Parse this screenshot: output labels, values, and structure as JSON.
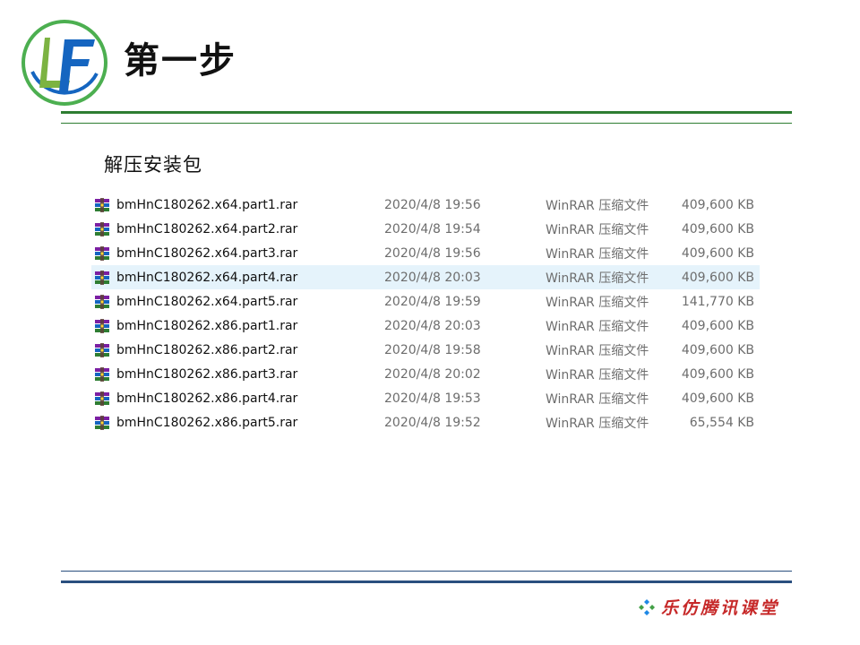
{
  "header": {
    "logo_text": "LF",
    "title": "第一步"
  },
  "section": {
    "subtitle": "解压安装包"
  },
  "files": [
    {
      "name": "bmHnC180262.x64.part1.rar",
      "date": "2020/4/8 19:56",
      "type": "WinRAR 压缩文件",
      "size": "409,600 KB",
      "icon": "winrar-archive-icon",
      "selected": false
    },
    {
      "name": "bmHnC180262.x64.part2.rar",
      "date": "2020/4/8 19:54",
      "type": "WinRAR 压缩文件",
      "size": "409,600 KB",
      "icon": "winrar-archive-icon",
      "selected": false
    },
    {
      "name": "bmHnC180262.x64.part3.rar",
      "date": "2020/4/8 19:56",
      "type": "WinRAR 压缩文件",
      "size": "409,600 KB",
      "icon": "winrar-archive-icon",
      "selected": false
    },
    {
      "name": "bmHnC180262.x64.part4.rar",
      "date": "2020/4/8 20:03",
      "type": "WinRAR 压缩文件",
      "size": "409,600 KB",
      "icon": "winrar-archive-icon",
      "selected": true
    },
    {
      "name": "bmHnC180262.x64.part5.rar",
      "date": "2020/4/8 19:59",
      "type": "WinRAR 压缩文件",
      "size": "141,770 KB",
      "icon": "winrar-archive-icon",
      "selected": false
    },
    {
      "name": "bmHnC180262.x86.part1.rar",
      "date": "2020/4/8 20:03",
      "type": "WinRAR 压缩文件",
      "size": "409,600 KB",
      "icon": "winrar-archive-icon",
      "selected": false
    },
    {
      "name": "bmHnC180262.x86.part2.rar",
      "date": "2020/4/8 19:58",
      "type": "WinRAR 压缩文件",
      "size": "409,600 KB",
      "icon": "winrar-archive-icon",
      "selected": false
    },
    {
      "name": "bmHnC180262.x86.part3.rar",
      "date": "2020/4/8 20:02",
      "type": "WinRAR 压缩文件",
      "size": "409,600 KB",
      "icon": "winrar-archive-icon",
      "selected": false
    },
    {
      "name": "bmHnC180262.x86.part4.rar",
      "date": "2020/4/8 19:53",
      "type": "WinRAR 压缩文件",
      "size": "409,600 KB",
      "icon": "winrar-archive-icon",
      "selected": false
    },
    {
      "name": "bmHnC180262.x86.part5.rar",
      "date": "2020/4/8 19:52",
      "type": "WinRAR 压缩文件",
      "size": "65,554 KB",
      "icon": "winrar-archive-icon",
      "selected": false
    }
  ],
  "footer": {
    "brand": "乐仿腾讯课堂",
    "mark_icon": "four-diamond-icon"
  },
  "colors": {
    "accent_green": "#2e7d32",
    "accent_blue": "#2a4f7f",
    "selection": "#e5f3fb",
    "brand_red": "#c62828"
  }
}
